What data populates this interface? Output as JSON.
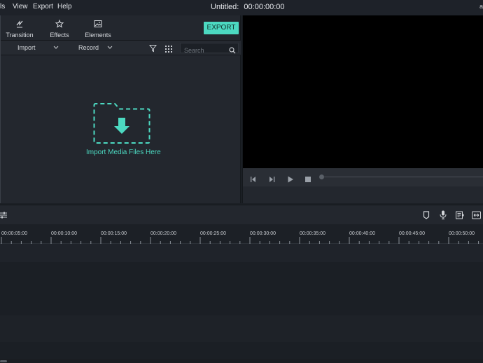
{
  "menubar": {
    "items": [
      "ls",
      "View",
      "Export",
      "Help"
    ],
    "title": "Untitled:",
    "timecode": "00:00:00:00",
    "overflow": "a"
  },
  "library": {
    "tabs": [
      {
        "label": "Transition",
        "icon": "transition-icon"
      },
      {
        "label": "Effects",
        "icon": "effects-icon"
      },
      {
        "label": "Elements",
        "icon": "elements-icon"
      }
    ],
    "export_label": "EXPORT",
    "toolbar": {
      "import_label": "Import",
      "record_label": "Record",
      "search_placeholder": "Search"
    },
    "drop_text": "Import Media Files Here"
  },
  "ruler": {
    "labels": [
      "00:00:05:00",
      "00:00:10:00",
      "00:00:15:00",
      "00:00:20:00",
      "00:00:25:00",
      "00:00:30:00",
      "00:00:35:00",
      "00:00:40:00",
      "00:00:45:00",
      "00:00:50:00"
    ]
  },
  "colors": {
    "accent": "#4cd9c1",
    "background": "#1b1f25",
    "video": "#000000"
  }
}
